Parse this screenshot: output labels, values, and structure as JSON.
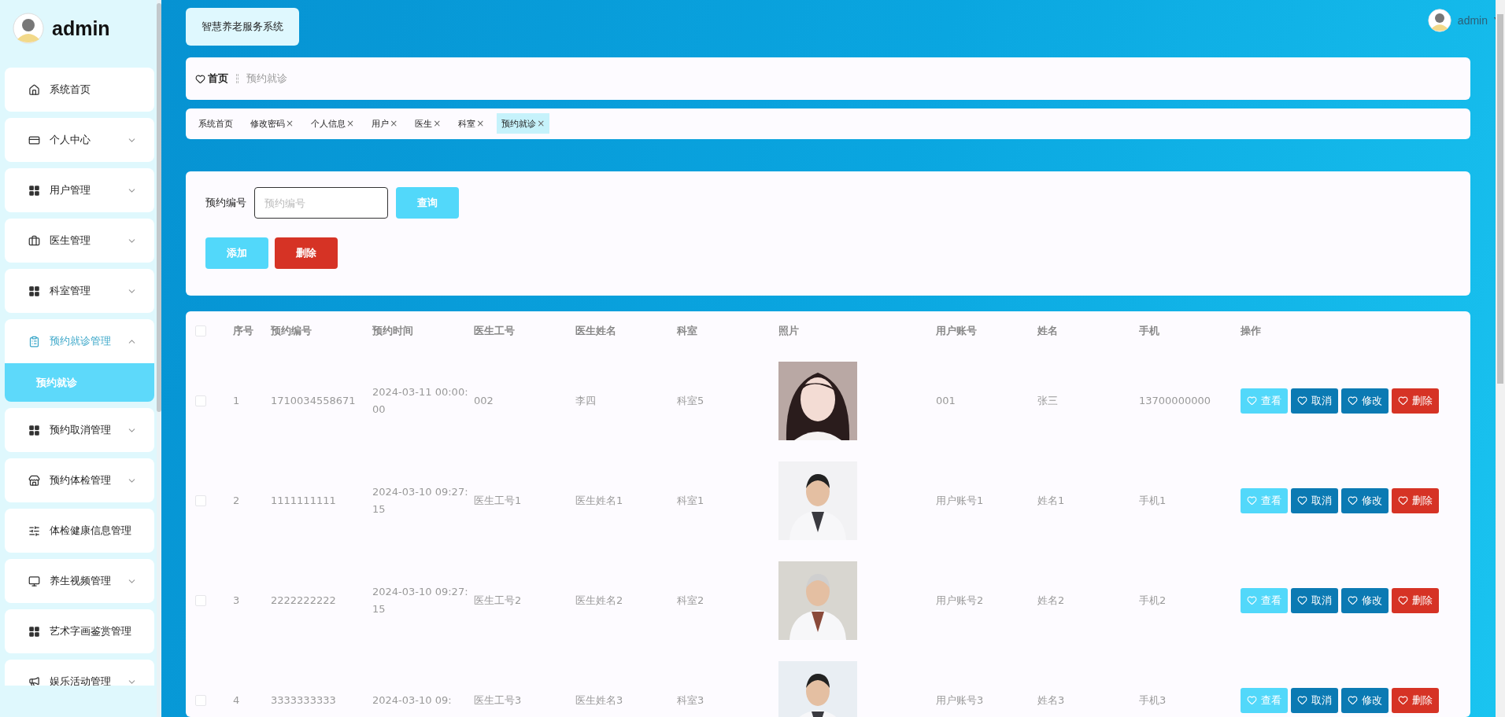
{
  "sidebar": {
    "title": "admin",
    "items": [
      {
        "label": "系统首页"
      },
      {
        "label": "个人中心",
        "expanded": false
      },
      {
        "label": "用户管理",
        "expanded": false
      },
      {
        "label": "医生管理",
        "expanded": false
      },
      {
        "label": "科室管理",
        "expanded": false
      },
      {
        "label": "预约就诊管理",
        "expanded": true,
        "children": [
          {
            "label": "预约就诊",
            "selected": true
          }
        ]
      },
      {
        "label": "预约取消管理",
        "expanded": false
      },
      {
        "label": "预约体检管理",
        "expanded": false
      },
      {
        "label": "体检健康信息管理"
      },
      {
        "label": "养生视频管理",
        "expanded": false
      },
      {
        "label": "艺术字画鉴赏管理"
      },
      {
        "label": "娱乐活动管理",
        "expanded": false
      }
    ]
  },
  "header": {
    "system_title": "智慧养老服务系统",
    "user": "admin"
  },
  "breadcrumb": {
    "home": "首页",
    "current": "预约就诊"
  },
  "tabs": [
    {
      "label": "系统首页",
      "selected": false
    },
    {
      "label": "修改密码",
      "close": "×",
      "selected": false
    },
    {
      "label": "个人信息",
      "close": "×",
      "selected": false
    },
    {
      "label": "用户",
      "close": "×",
      "selected": false
    },
    {
      "label": "医生",
      "close": "×",
      "selected": false
    },
    {
      "label": "科室",
      "close": "×",
      "selected": false
    },
    {
      "label": "预约就诊",
      "close": "×",
      "selected": true
    }
  ],
  "search": {
    "label": "预约编号",
    "placeholder": "预约编号",
    "query_button": "查询",
    "add_button": "添加",
    "delete_button": "删除"
  },
  "table": {
    "select_all_checked": false,
    "columns": [
      "序号",
      "预约编号",
      "预约时间",
      "医生工号",
      "医生姓名",
      "科室",
      "照片",
      "用户账号",
      "姓名",
      "手机",
      "操作"
    ],
    "rows": [
      {
        "checked": false,
        "index": "1",
        "booking_no": "1710034558671",
        "time": "2024-03-11 00:00:00",
        "doctor_id": "002",
        "doctor_name": "李四",
        "department": "科室5",
        "user_account": "001",
        "name": "张三",
        "phone": "13700000000",
        "actions": [
          {
            "label": "查看",
            "kind": "view"
          },
          {
            "label": "取消",
            "kind": "cancel"
          },
          {
            "label": "修改",
            "kind": "edit"
          },
          {
            "label": "删除",
            "kind": "delete"
          }
        ]
      },
      {
        "checked": false,
        "index": "2",
        "booking_no": "1111111111",
        "time": "2024-03-10 09:27:15",
        "doctor_id": "医生工号1",
        "doctor_name": "医生姓名1",
        "department": "科室1",
        "user_account": "用户账号1",
        "name": "姓名1",
        "phone": "手机1",
        "actions": [
          {
            "label": "查看",
            "kind": "view"
          },
          {
            "label": "取消",
            "kind": "cancel"
          },
          {
            "label": "修改",
            "kind": "edit"
          },
          {
            "label": "删除",
            "kind": "delete"
          }
        ]
      },
      {
        "checked": false,
        "index": "3",
        "booking_no": "2222222222",
        "time": "2024-03-10 09:27:15",
        "doctor_id": "医生工号2",
        "doctor_name": "医生姓名2",
        "department": "科室2",
        "user_account": "用户账号2",
        "name": "姓名2",
        "phone": "手机2",
        "actions": [
          {
            "label": "查看",
            "kind": "view"
          },
          {
            "label": "取消",
            "kind": "cancel"
          },
          {
            "label": "修改",
            "kind": "edit"
          },
          {
            "label": "删除",
            "kind": "delete"
          }
        ]
      },
      {
        "checked": false,
        "index": "4",
        "booking_no": "3333333333",
        "time": "2024-03-10 09:",
        "doctor_id": "医生工号3",
        "doctor_name": "医生姓名3",
        "department": "科室3",
        "user_account": "用户账号3",
        "name": "姓名3",
        "phone": "手机3",
        "actions": [
          {
            "label": "查看",
            "kind": "view"
          },
          {
            "label": "取消",
            "kind": "cancel"
          },
          {
            "label": "修改",
            "kind": "edit"
          },
          {
            "label": "删除",
            "kind": "delete"
          }
        ]
      }
    ]
  }
}
